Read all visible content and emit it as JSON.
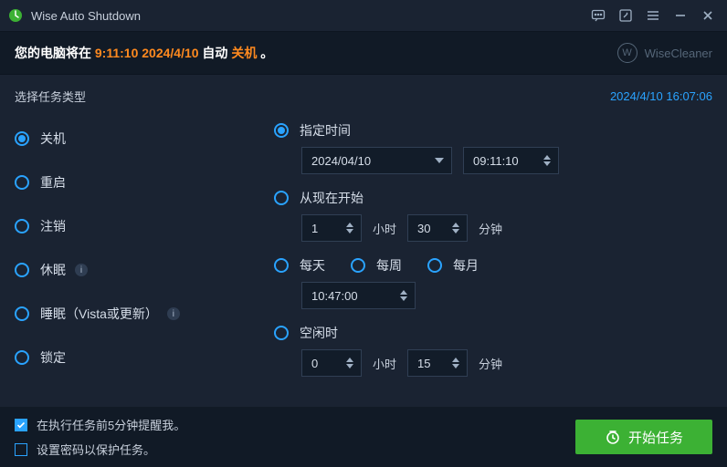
{
  "app": {
    "title": "Wise Auto Shutdown"
  },
  "banner": {
    "pre": "您的电脑将在 ",
    "time": "9:11:10 2024/4/10",
    "mid": " 自动 ",
    "action": "关机",
    "post": " 。",
    "brand": "WiseCleaner",
    "brand_initial": "W"
  },
  "section": {
    "label": "选择任务类型",
    "clock": "2024/4/10 16:07:06"
  },
  "task_types": {
    "shutdown": "关机",
    "restart": "重启",
    "logoff": "注销",
    "hibernate": "休眠",
    "sleep": "睡眠（Vista或更新）",
    "lock": "锁定",
    "info_glyph": "i"
  },
  "schedule": {
    "specified": {
      "label": "指定时间",
      "date": "2024/04/10",
      "time": "09:11:10"
    },
    "from_now": {
      "label": "从现在开始",
      "hours": "1",
      "hours_unit": "小时",
      "minutes": "30",
      "minutes_unit": "分钟"
    },
    "recurrence": {
      "daily": "每天",
      "weekly": "每周",
      "monthly": "每月",
      "time": "10:47:00"
    },
    "idle": {
      "label": "空闲时",
      "hours": "0",
      "hours_unit": "小时",
      "minutes": "15",
      "minutes_unit": "分钟"
    }
  },
  "footer": {
    "remind": "在执行任务前5分钟提醒我。",
    "password": "设置密码以保护任务。",
    "start": "开始任务"
  }
}
